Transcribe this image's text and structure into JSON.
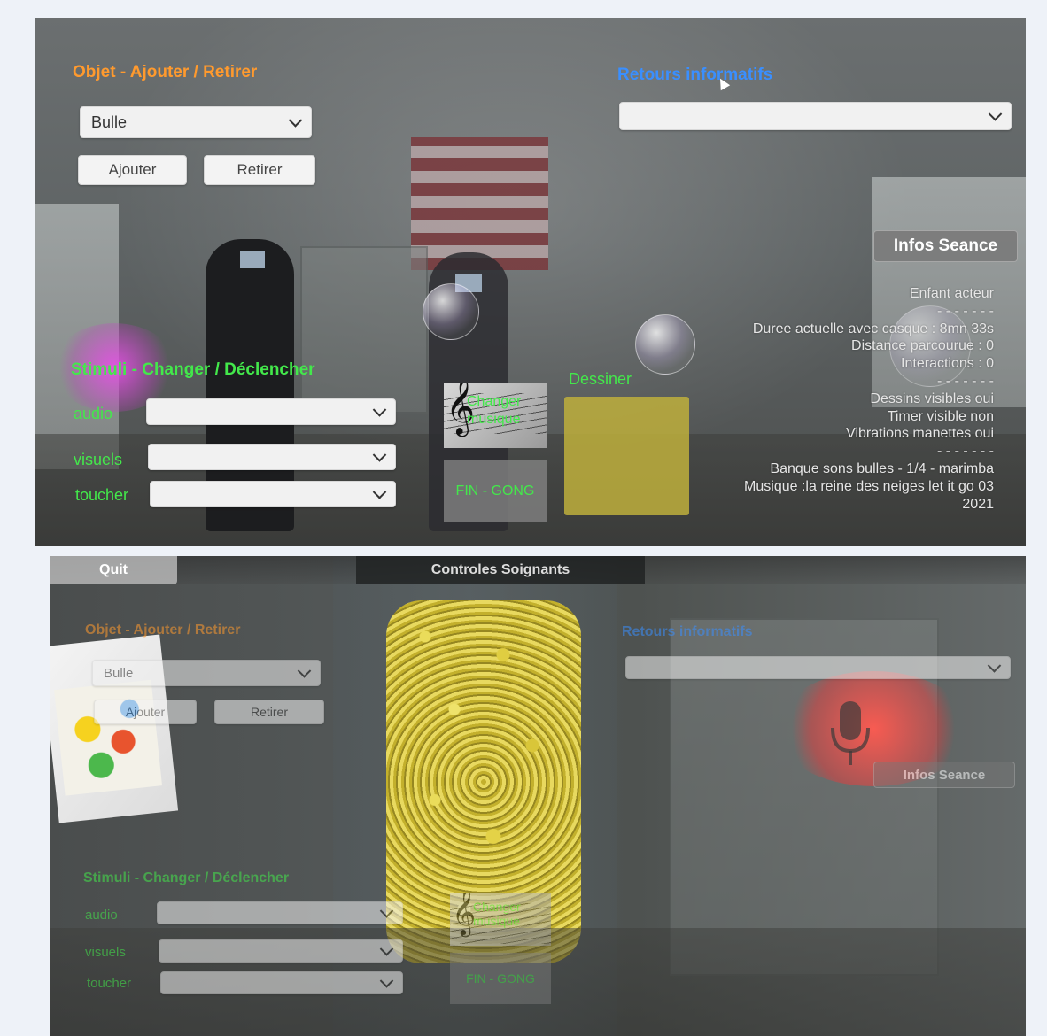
{
  "top": {
    "object_heading": "Objet - Ajouter / Retirer",
    "object_select_value": "Bulle",
    "add_label": "Ajouter",
    "remove_label": "Retirer",
    "feedback_heading": "Retours informatifs",
    "feedback_select_value": "",
    "session_info_button": "Infos Seance",
    "session_info_lines": [
      "Enfant acteur",
      "- - - - - - -",
      "Duree actuelle avec casque : 8mn 33s",
      "Distance parcourue : 0",
      "Interactions : 0",
      "- - - - - - -",
      "Dessins visibles oui",
      "Timer visible non",
      "Vibrations manettes oui",
      "- - - - - - -",
      "Banque sons bulles - 1/4 - marimba",
      "Musique :la reine des neiges let it go 03",
      "2021"
    ],
    "stimuli_heading": "Stimuli - Changer / Déclencher",
    "audio_label": "audio",
    "visuals_label": "visuels",
    "touch_label": "toucher",
    "audio_value": "",
    "visuals_value": "",
    "touch_value": "",
    "change_music_label": "Changer musique",
    "end_gong_label": "FIN - GONG",
    "draw_label": "Dessiner"
  },
  "bottom": {
    "quit_label": "Quit",
    "window_title": "Controles Soignants",
    "object_heading": "Objet - Ajouter / Retirer",
    "object_select_value": "Bulle",
    "add_label": "Ajouter",
    "remove_label": "Retirer",
    "feedback_heading": "Retours informatifs",
    "session_info_button": "Infos Seance",
    "stimuli_heading": "Stimuli - Changer / Déclencher",
    "audio_label": "audio",
    "visuals_label": "visuels",
    "touch_label": "toucher",
    "change_music_label": "Changer musique",
    "end_gong_label": "FIN - GONG"
  },
  "colors": {
    "orange_heading": "#ff9a2e",
    "blue_heading": "#3a8fff",
    "green_text": "#43e84b",
    "draw_pad": "#bfae3c"
  },
  "icons": [
    "treble-clef-icon",
    "chevron-down-icon",
    "microphone-icon",
    "cursor-icon"
  ]
}
